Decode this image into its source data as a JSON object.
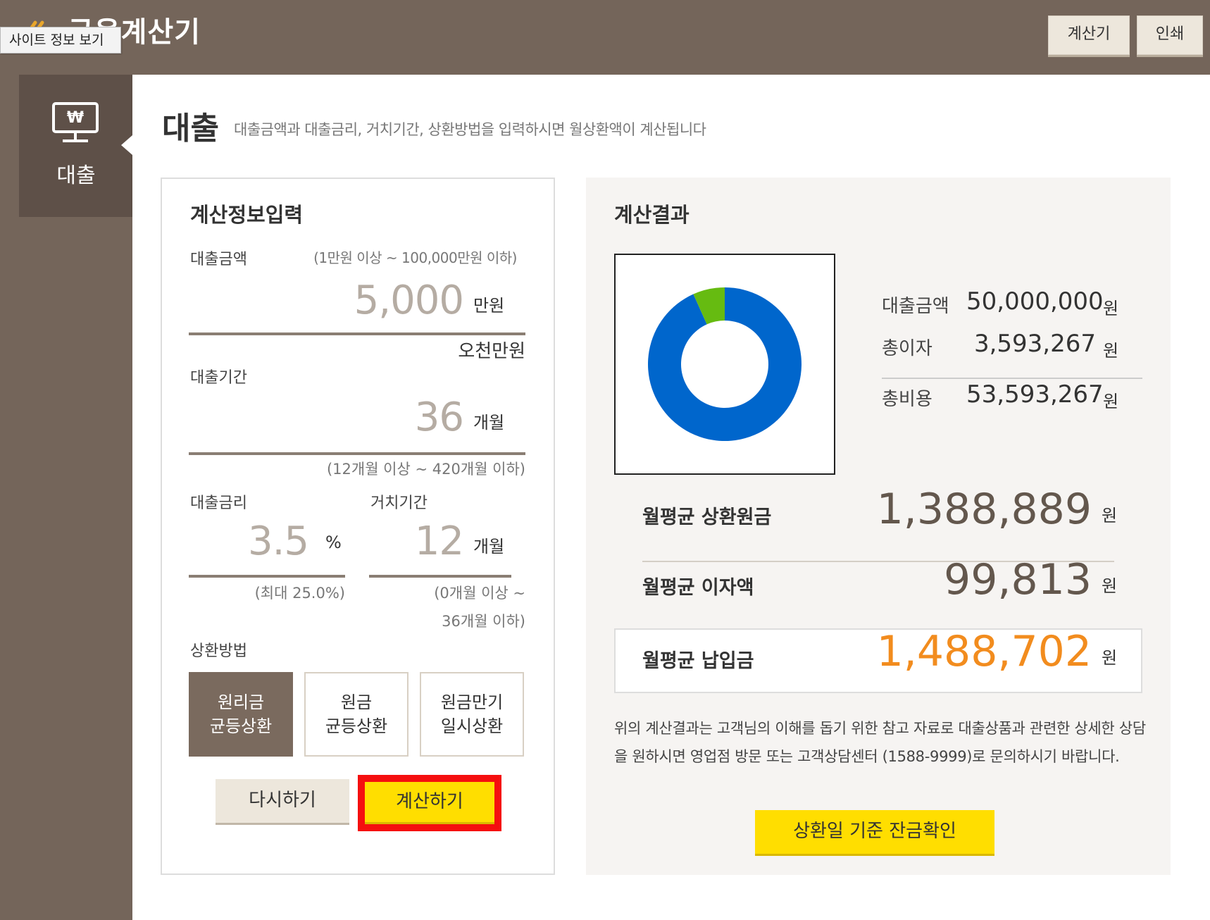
{
  "header": {
    "site_info_tooltip": "사이트 정보 보기",
    "app_title": "금융계산기",
    "buttons": {
      "calculator": "계산기",
      "print": "인쇄"
    }
  },
  "side_nav": {
    "items": [
      {
        "label": "대출",
        "icon": "won-monitor-icon",
        "active": true
      }
    ]
  },
  "page": {
    "title": "대출",
    "description": "대출금액과 대출금리, 거치기간, 상환방법을 입력하시면 월상환액이 계산됩니다"
  },
  "input": {
    "title": "계산정보입력",
    "loan_amount": {
      "label": "대출금액",
      "range_hint": "(1만원 이상 ~ 100,000만원 이하)",
      "value": "5,000",
      "unit": "만원",
      "korean_reading": "오천만원"
    },
    "loan_period": {
      "label": "대출기간",
      "value": "36",
      "unit": "개월",
      "range_hint": "(12개월 이상 ~ 420개월 이하)"
    },
    "interest_rate": {
      "label": "대출금리",
      "value": "3.5",
      "unit": "%",
      "hint": "(최대 25.0%)"
    },
    "grace_period": {
      "label": "거치기간",
      "value": "12",
      "unit": "개월",
      "hint_line1": "(0개월 이상 ~",
      "hint_line2": "36개월 이하)"
    },
    "repayment_method": {
      "label": "상환방법",
      "options": [
        {
          "line1": "원리금",
          "line2": "균등상환",
          "selected": true
        },
        {
          "line1": "원금",
          "line2": "균등상환",
          "selected": false
        },
        {
          "line1": "원금만기",
          "line2": "일시상환",
          "selected": false
        }
      ]
    },
    "reset_button": "다시하기",
    "calculate_button": "계산하기"
  },
  "result": {
    "title": "계산결과",
    "summary": {
      "loan_amount": {
        "label": "대출금액",
        "value": "50,000,000",
        "unit": "원"
      },
      "total_interest": {
        "label": "총이자",
        "value": "3,593,267",
        "unit": "원"
      },
      "total_cost": {
        "label": "총비용",
        "value": "53,593,267",
        "unit": "원"
      }
    },
    "monthly_principal": {
      "label": "월평균 상환원금",
      "value": "1,388,889",
      "unit": "원"
    },
    "monthly_interest": {
      "label": "월평균 이자액",
      "value": "99,813",
      "unit": "원"
    },
    "monthly_payment": {
      "label": "월평균 납입금",
      "value": "1,488,702",
      "unit": "원"
    },
    "notice": "위의 계산결과는 고객님의 이해를 돕기 위한 참고 자료로 대출상품과 관련한 상세한 상담을 원하시면 영업점 방문 또는 고객상담센터 (1588-9999)로 문의하시기 바랍니다.",
    "balance_button": "상환일 기준 잔금확인"
  },
  "chart_data": {
    "type": "pie",
    "categories": [
      "대출금액",
      "총이자"
    ],
    "values": [
      50000000,
      3593267
    ],
    "colors": [
      "#0066cc",
      "#66bb11"
    ]
  },
  "colors": {
    "brown": "#74655a",
    "yellow": "#ffde00",
    "orange": "#f28c1e",
    "highlight_border": "#f50f0f"
  }
}
